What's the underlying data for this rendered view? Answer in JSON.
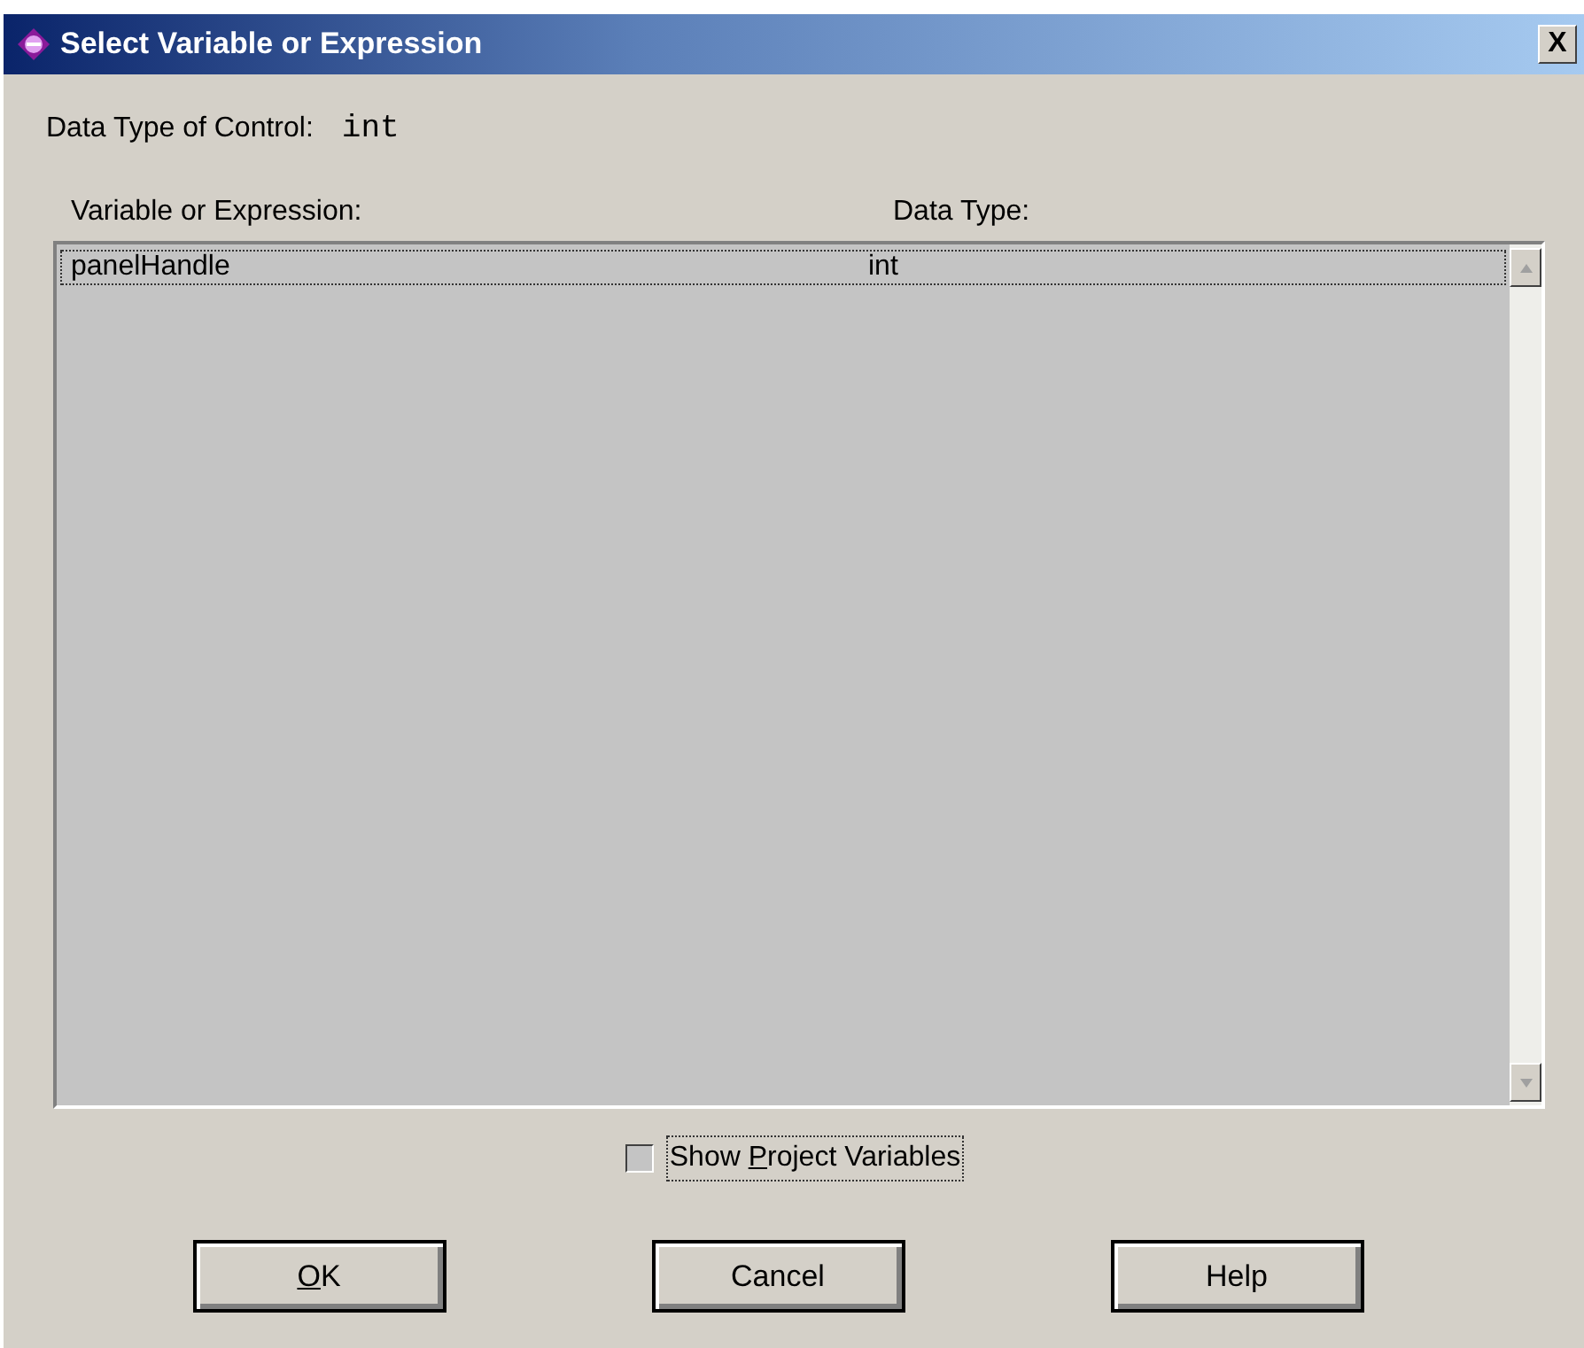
{
  "window": {
    "title": "Select Variable or Expression",
    "close_label": "X"
  },
  "control_type": {
    "label": "Data Type of Control:",
    "value": "int"
  },
  "list": {
    "columns": [
      "Variable or Expression:",
      "Data Type:"
    ],
    "rows": [
      {
        "cells": [
          "panelHandle",
          "int"
        ],
        "selected": true
      }
    ]
  },
  "show_project_variables": {
    "before": "Show ",
    "access_key": "P",
    "after": "roject Variables",
    "checked": false,
    "focused": true
  },
  "buttons": [
    {
      "access_key": "O",
      "after": "K"
    },
    {
      "after": "Cancel"
    },
    {
      "after": "Help"
    }
  ]
}
